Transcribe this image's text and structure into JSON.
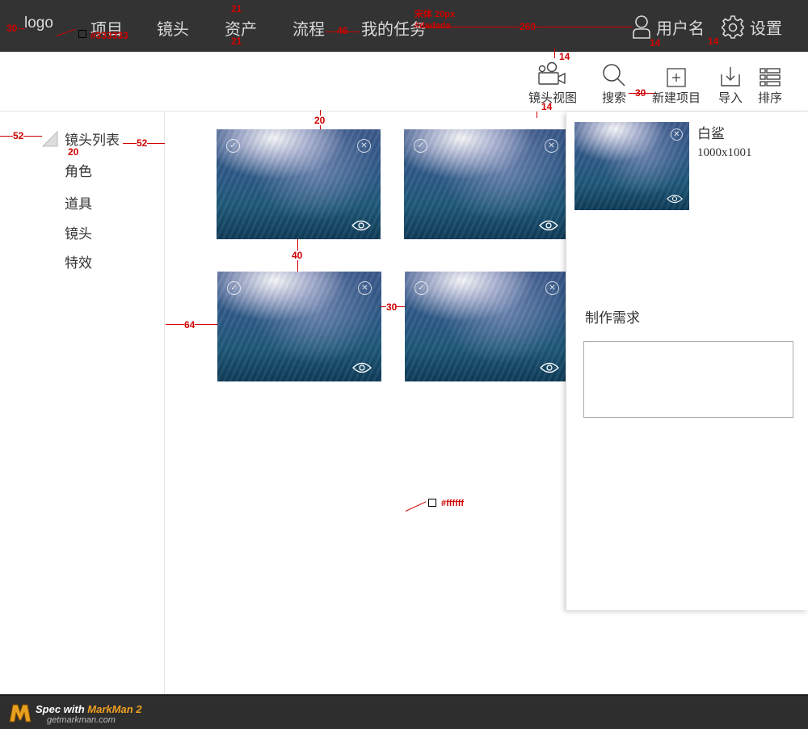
{
  "topbar": {
    "logo": "logo",
    "nav": [
      "项目",
      "镜头",
      "资产",
      "流程",
      "我的任务"
    ],
    "user": "用户名",
    "settings": "设置",
    "bg_color": "#333333",
    "text_color": "#dadada"
  },
  "toolbar": {
    "items": [
      {
        "label": "镜头视图",
        "icon": "camera-view-icon"
      },
      {
        "label": "搜索",
        "icon": "search-icon"
      },
      {
        "label": "新建项目",
        "icon": "add-icon"
      },
      {
        "label": "导入",
        "icon": "import-icon"
      },
      {
        "label": "排序",
        "icon": "list-sort-icon"
      }
    ]
  },
  "sidebar": {
    "header": "镜头列表",
    "items": [
      "角色",
      "道具",
      "镜头",
      "特效"
    ]
  },
  "grid": {
    "items": [
      {
        "icon_select": "check-circle-icon",
        "icon_close": "close-circle-icon",
        "icon_view": "eye-icon"
      },
      {
        "icon_select": "check-circle-icon",
        "icon_close": "close-circle-icon",
        "icon_view": "eye-icon"
      },
      {
        "icon_select": "check-circle-icon",
        "icon_close": "close-circle-icon",
        "icon_view": "eye-icon"
      },
      {
        "icon_select": "check-circle-icon",
        "icon_close": "close-circle-icon",
        "icon_view": "eye-icon"
      }
    ]
  },
  "panel": {
    "name": "白鲨",
    "size": "1000x1001",
    "requirement_label": "制作需求",
    "requirement_value": ""
  },
  "footer": {
    "title_prefix": "Spec with ",
    "title_brand": "MarkMan 2",
    "subtitle": "getmarkman.com"
  },
  "annotations": {
    "logo_left": "30",
    "bg_color": "#333333",
    "nav_top": "21",
    "nav_bottom": "21",
    "nav_gap": "46",
    "font_spec": "宋体 20px",
    "font_color": "#dadada",
    "right_gap": "260",
    "icon_gap_1": "14",
    "icon_gap_2": "14",
    "toolbar_top": "14",
    "toolbar_bottom": "14",
    "toolbar_gap": "30",
    "side_left": "52",
    "side_right": "52",
    "side_spacing": "20",
    "grid_top": "20",
    "grid_row_gap": "40",
    "grid_left": "64",
    "grid_col_gap": "30",
    "page_bg": "#ffffff"
  }
}
